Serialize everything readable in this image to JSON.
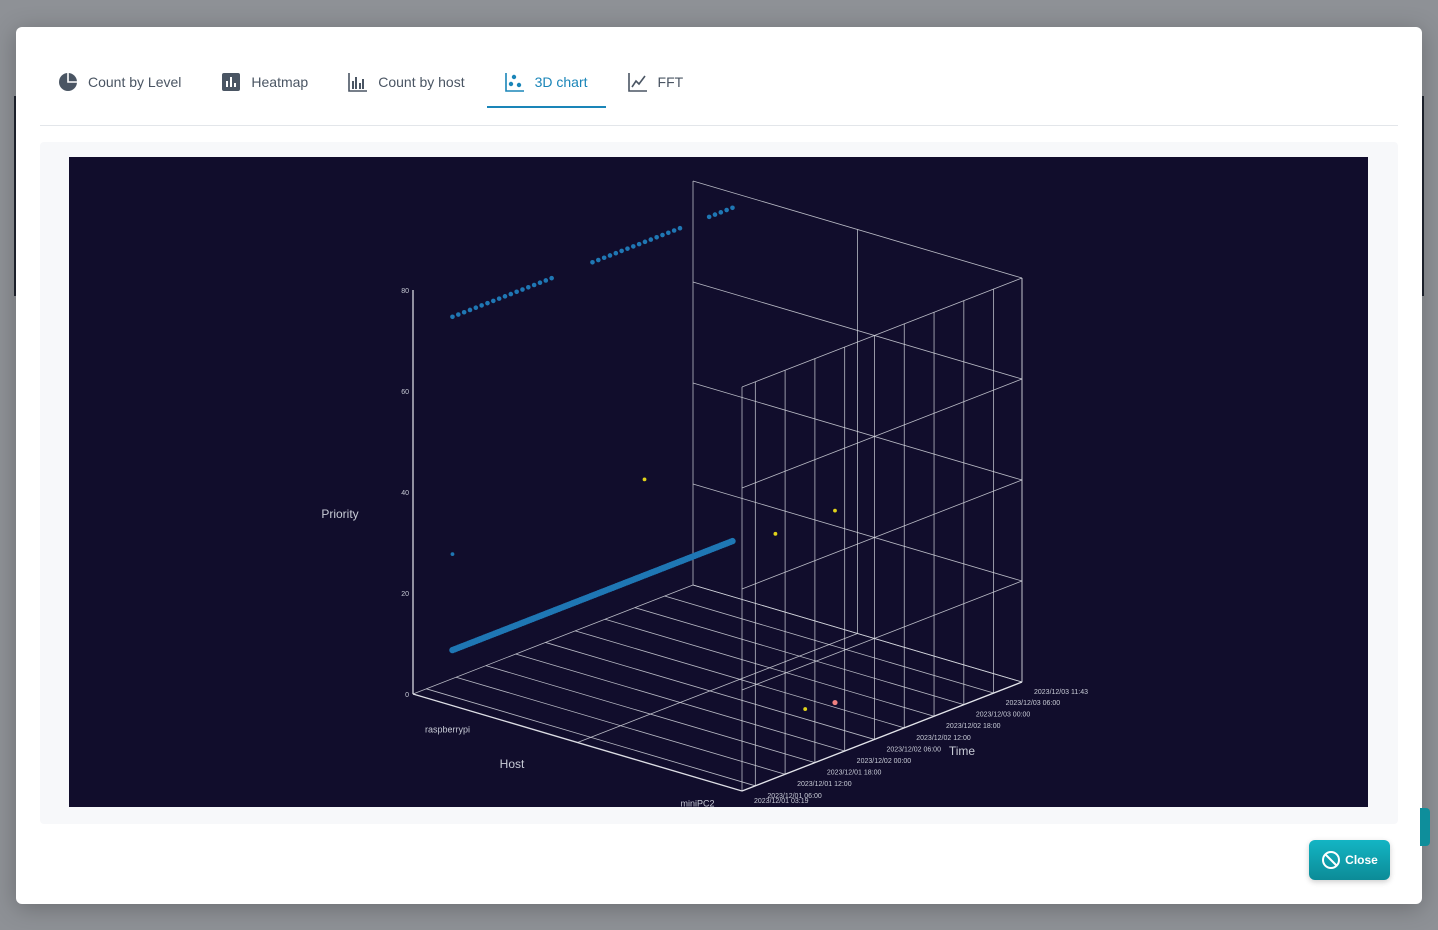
{
  "tabs": [
    {
      "label": "Count by Level",
      "icon": "pie-chart-icon",
      "active": false
    },
    {
      "label": "Heatmap",
      "icon": "bar-chart-icon",
      "active": false
    },
    {
      "label": "Count by host",
      "icon": "grouped-bar-icon",
      "active": false
    },
    {
      "label": "3D chart",
      "icon": "scatter-icon",
      "active": true
    },
    {
      "label": "FFT",
      "icon": "line-chart-icon",
      "active": false
    }
  ],
  "close_label": "Close",
  "colors": {
    "accent": "#1a85b8",
    "plot_bg": "#110d2c",
    "series_main": "#1f77b4",
    "series_yellow": "#e0d21a",
    "series_pink": "#f08080",
    "close_button": "#0f9faa"
  },
  "chart_data": {
    "type": "scatter",
    "mode": "3d",
    "axes": {
      "x": {
        "label": "Host",
        "categories": [
          "raspberrypi",
          "miniPC2"
        ]
      },
      "y": {
        "label": "Time",
        "ticks": [
          "2023/12/01 03:19",
          "2023/12/01 06:00",
          "2023/12/01 12:00",
          "2023/12/01 18:00",
          "2023/12/02 00:00",
          "2023/12/02 06:00",
          "2023/12/02 12:00",
          "2023/12/02 18:00",
          "2023/12/03 00:00",
          "2023/12/03 06:00",
          "2023/12/03 11:43"
        ],
        "range": [
          "2023/12/01 03:19",
          "2023/12/03 11:43"
        ]
      },
      "z": {
        "label": "Priority",
        "ticks": [
          0,
          20,
          40,
          60,
          80
        ],
        "range": [
          0,
          80
        ]
      }
    },
    "grid": true,
    "series": [
      {
        "color": "#1f77b4",
        "points": [
          {
            "host": "raspberrypi",
            "time": "2023/12/01 03:19",
            "priority": 11
          },
          {
            "host": "raspberrypi",
            "time": "2023/12/03 11:43",
            "priority": 11
          },
          {
            "host": "raspberrypi",
            "time": "2023/12/01 03:19",
            "priority": 77
          },
          {
            "host": "raspberrypi",
            "time": "2023/12/03 11:43",
            "priority": 77
          },
          {
            "host": "raspberrypi",
            "time": "2023/12/01 03:19",
            "priority": 30
          }
        ]
      },
      {
        "color": "#e0d21a",
        "points": [
          {
            "host": "miniPC2",
            "time": "2023/12/01 18:00",
            "priority": 43
          },
          {
            "host": "miniPC2",
            "time": "2023/12/02 06:00",
            "priority": 43
          },
          {
            "host": "miniPC2",
            "time": "2023/12/02 00:00",
            "priority": 6
          },
          {
            "host": "raspberrypi",
            "time": "2023/12/02 18:00",
            "priority": 30
          }
        ]
      },
      {
        "color": "#f08080",
        "points": [
          {
            "host": "miniPC2",
            "time": "2023/12/02 06:00",
            "priority": 5
          }
        ]
      }
    ]
  }
}
